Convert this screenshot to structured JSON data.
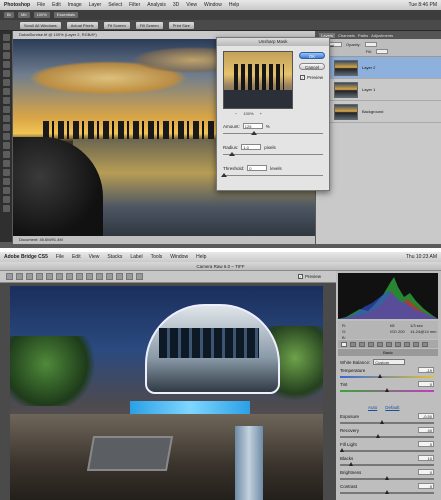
{
  "photoshop": {
    "menubar": {
      "app": "Photoshop",
      "items": [
        "File",
        "Edit",
        "Image",
        "Layer",
        "Select",
        "Filter",
        "Analysis",
        "3D",
        "View",
        "Window",
        "Help"
      ],
      "clock": "Tue 8:46 PM"
    },
    "appbar": {
      "chips": [
        "Br",
        "Mb",
        "100%",
        "Essentials"
      ]
    },
    "options_bar": {
      "buttons": [
        "Scroll All Windows",
        "Actual Pixels",
        "Fit Screen",
        "Fill Screen",
        "Print Size"
      ]
    },
    "document": {
      "tab": "DubaiSunrise.tif @ 100% (Layer 2, RGB/8*)",
      "status": "Document: 45.6M/91.4M"
    },
    "panels": {
      "tabs": [
        "Layers",
        "Channels",
        "Paths",
        "Adjustments"
      ],
      "active_tab": "Layers",
      "blend_mode": "Normal",
      "opacity_label": "Opacity:",
      "fill_label": "Fill:",
      "lock_label": "Lock:",
      "layers": [
        {
          "name": "Layer 2",
          "selected": true
        },
        {
          "name": "Layer 1",
          "selected": false
        },
        {
          "name": "Background",
          "selected": false
        }
      ]
    },
    "unsharp_mask": {
      "title": "Unsharp Mask",
      "ok_label": "OK",
      "cancel_label": "Cancel",
      "preview_label": "Preview",
      "preview_checked": true,
      "zoom_minus": "−",
      "zoom_value": "100%",
      "zoom_plus": "+",
      "amount_label": "Amount:",
      "amount_value": "125",
      "amount_unit": "%",
      "radius_label": "Radius:",
      "radius_value": "1.0",
      "radius_unit": "pixels",
      "threshold_label": "Threshold:",
      "threshold_value": "0",
      "threshold_unit": "levels"
    }
  },
  "camera_raw": {
    "menubar": {
      "app": "Adobe Bridge CS5",
      "items": [
        "File",
        "Edit",
        "View",
        "Stacks",
        "Label",
        "Tools",
        "Window",
        "Help"
      ],
      "clock": "Thu 10:23 AM"
    },
    "window_title": "Camera Raw 6.0 – TIFF",
    "preview_label": "Preview",
    "preview_checked": true,
    "info": {
      "r": "R:",
      "g": "G:",
      "b": "B:",
      "aperture": "f/8",
      "shutter": "1/3 sec",
      "iso": "ISO 200",
      "lens": "14-24@14 mm"
    },
    "section_title": "Basic",
    "white_balance_label": "White Balance:",
    "white_balance_value": "Custom",
    "auto_label": "Auto",
    "default_label": "Default",
    "sliders": [
      {
        "label": "Temperature",
        "value": "-19",
        "pos": 0.42
      },
      {
        "label": "Tint",
        "value": "0",
        "pos": 0.5
      },
      {
        "label": "Exposure",
        "value": "-0.50",
        "pos": 0.44
      },
      {
        "label": "Recovery",
        "value": "40",
        "pos": 0.4
      },
      {
        "label": "Fill Light",
        "value": "0",
        "pos": 0.0
      },
      {
        "label": "Blacks",
        "value": "10",
        "pos": 0.1
      },
      {
        "label": "Brightness",
        "value": "0",
        "pos": 0.5
      },
      {
        "label": "Contrast",
        "value": "0",
        "pos": 0.5
      },
      {
        "label": "Clarity",
        "value": "0",
        "pos": 0.5
      },
      {
        "label": "Vibrance",
        "value": "0",
        "pos": 0.5
      },
      {
        "label": "Saturation",
        "value": "0",
        "pos": 0.5
      }
    ]
  },
  "colors": {
    "selected_layer": "#8db0dd",
    "ok_button": "#3d7fd6",
    "link_blue": "#1a4f9c"
  }
}
